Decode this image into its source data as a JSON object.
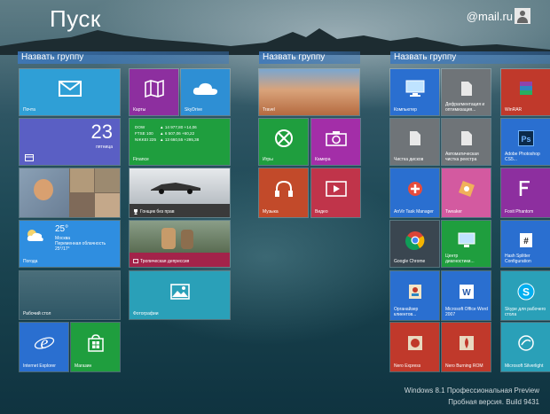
{
  "header": {
    "title": "Пуск",
    "user": "@mail.ru"
  },
  "groups": {
    "g1": "Назвать группу",
    "g2": "Назвать группу",
    "g3": "Назвать группу"
  },
  "tiles": {
    "mail": "Почта",
    "maps": "Карты",
    "skydrive": "SkyDrive",
    "calendar_day": "23",
    "calendar_weekday": "пятница",
    "finance": "Finance",
    "finance_rows": [
      {
        "name": "DOW",
        "value": "▲ 14 977,80 +14,06"
      },
      {
        "name": "FTSE 100",
        "value": "▲ 6 507,06 +60,22"
      },
      {
        "name": "NIKKEI 225",
        "value": "▲ 13 660,55 +295,38"
      }
    ],
    "racing": "Гонщик без прав",
    "weather_temp": "25°",
    "weather_city": "Москва",
    "weather_desc": "Переменная облачность",
    "weather_range": "25°/17°",
    "weather": "Погода",
    "desktop": "Рабочий стол",
    "photos": "Фотографии",
    "tropical": "Тропическая депрессия",
    "ie": "Internet Explorer",
    "store": "Магазин",
    "travel": "Travel",
    "games": "Игры",
    "camera": "Камера",
    "music": "Музыка",
    "video": "Видео",
    "computer": "Компьютер",
    "defrag": "Дефрагментация и оптимизация...",
    "winrar": "WinRAR",
    "diskclean": "Чистка дисков",
    "regclean": "Автоматическая чистка реестра",
    "photoshop": "Adobe Photoshop CS5...",
    "antivir": "AnVir Task Manager",
    "tweaker": "Tweaker",
    "foxit": "Foxit Phantom",
    "chrome": "Google Chrome",
    "diagcenter": "Центр диагностики...",
    "hashsplitter": "Hash Splitter Configuration",
    "organizer": "Органайзер клиентов...",
    "word": "Microsoft Office Word 2007",
    "skype": "Skype для рабочего стола",
    "nero_express": "Nero Express",
    "nero_burning": "Nero Burning ROM",
    "silverlight": "Microsoft Silverlight"
  },
  "footer": {
    "line1": "Windows 8.1 Профессиональная Preview",
    "line2": "Пробная версия. Build 9431"
  },
  "colors": {
    "accent": "#3a7bd5",
    "purple": "#7a2a8c",
    "green": "#1f8a3a",
    "blue": "#2a6fb8",
    "red": "#c0392b"
  }
}
